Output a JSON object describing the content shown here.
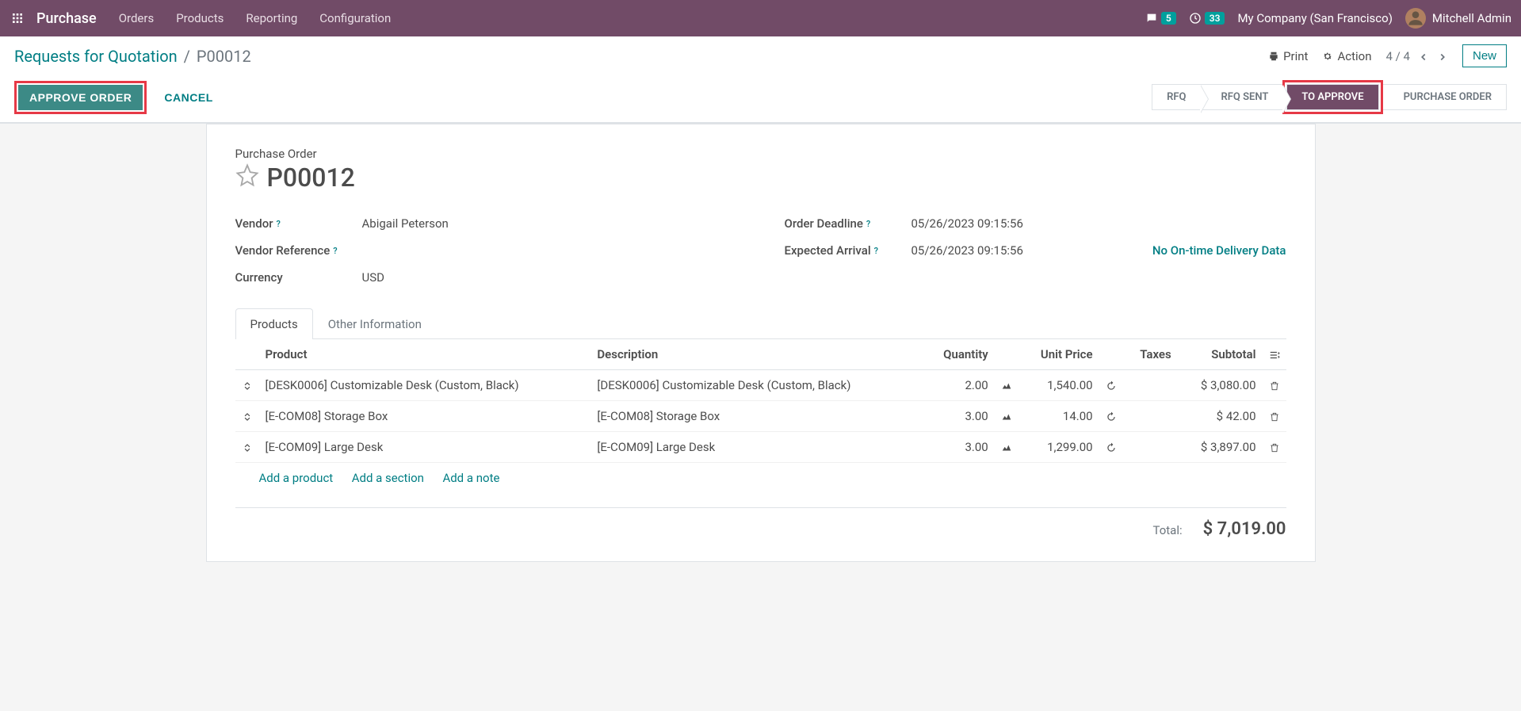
{
  "nav": {
    "brand": "Purchase",
    "menu": [
      "Orders",
      "Products",
      "Reporting",
      "Configuration"
    ],
    "messages_count": "5",
    "activities_count": "33",
    "company": "My Company (San Francisco)",
    "user": "Mitchell Admin"
  },
  "breadcrumb": {
    "parent": "Requests for Quotation",
    "current": "P00012"
  },
  "actions": {
    "print": "Print",
    "action": "Action",
    "pager": "4 / 4",
    "new": "New"
  },
  "buttons": {
    "approve": "APPROVE ORDER",
    "cancel": "CANCEL"
  },
  "stages": [
    "RFQ",
    "RFQ SENT",
    "TO APPROVE",
    "PURCHASE ORDER"
  ],
  "form": {
    "type_label": "Purchase Order",
    "name": "P00012",
    "fields": {
      "vendor_label": "Vendor",
      "vendor": "Abigail Peterson",
      "vendor_ref_label": "Vendor Reference",
      "vendor_ref": "",
      "currency_label": "Currency",
      "currency": "USD",
      "deadline_label": "Order Deadline",
      "deadline": "05/26/2023 09:15:56",
      "arrival_label": "Expected Arrival",
      "arrival": "05/26/2023 09:15:56",
      "delivery_link": "No On-time Delivery Data"
    }
  },
  "tabs": [
    "Products",
    "Other Information"
  ],
  "table": {
    "headers": {
      "product": "Product",
      "description": "Description",
      "quantity": "Quantity",
      "unit_price": "Unit Price",
      "taxes": "Taxes",
      "subtotal": "Subtotal"
    },
    "rows": [
      {
        "product": "[DESK0006] Customizable Desk (Custom, Black)",
        "description": "[DESK0006] Customizable Desk (Custom, Black)",
        "qty": "2.00",
        "price": "1,540.00",
        "subtotal": "$ 3,080.00"
      },
      {
        "product": "[E-COM08] Storage Box",
        "description": "[E-COM08] Storage Box",
        "qty": "3.00",
        "price": "14.00",
        "subtotal": "$ 42.00"
      },
      {
        "product": "[E-COM09] Large Desk",
        "description": "[E-COM09] Large Desk",
        "qty": "3.00",
        "price": "1,299.00",
        "subtotal": "$ 3,897.00"
      }
    ],
    "add": {
      "product": "Add a product",
      "section": "Add a section",
      "note": "Add a note"
    }
  },
  "totals": {
    "label": "Total:",
    "value": "$ 7,019.00"
  }
}
